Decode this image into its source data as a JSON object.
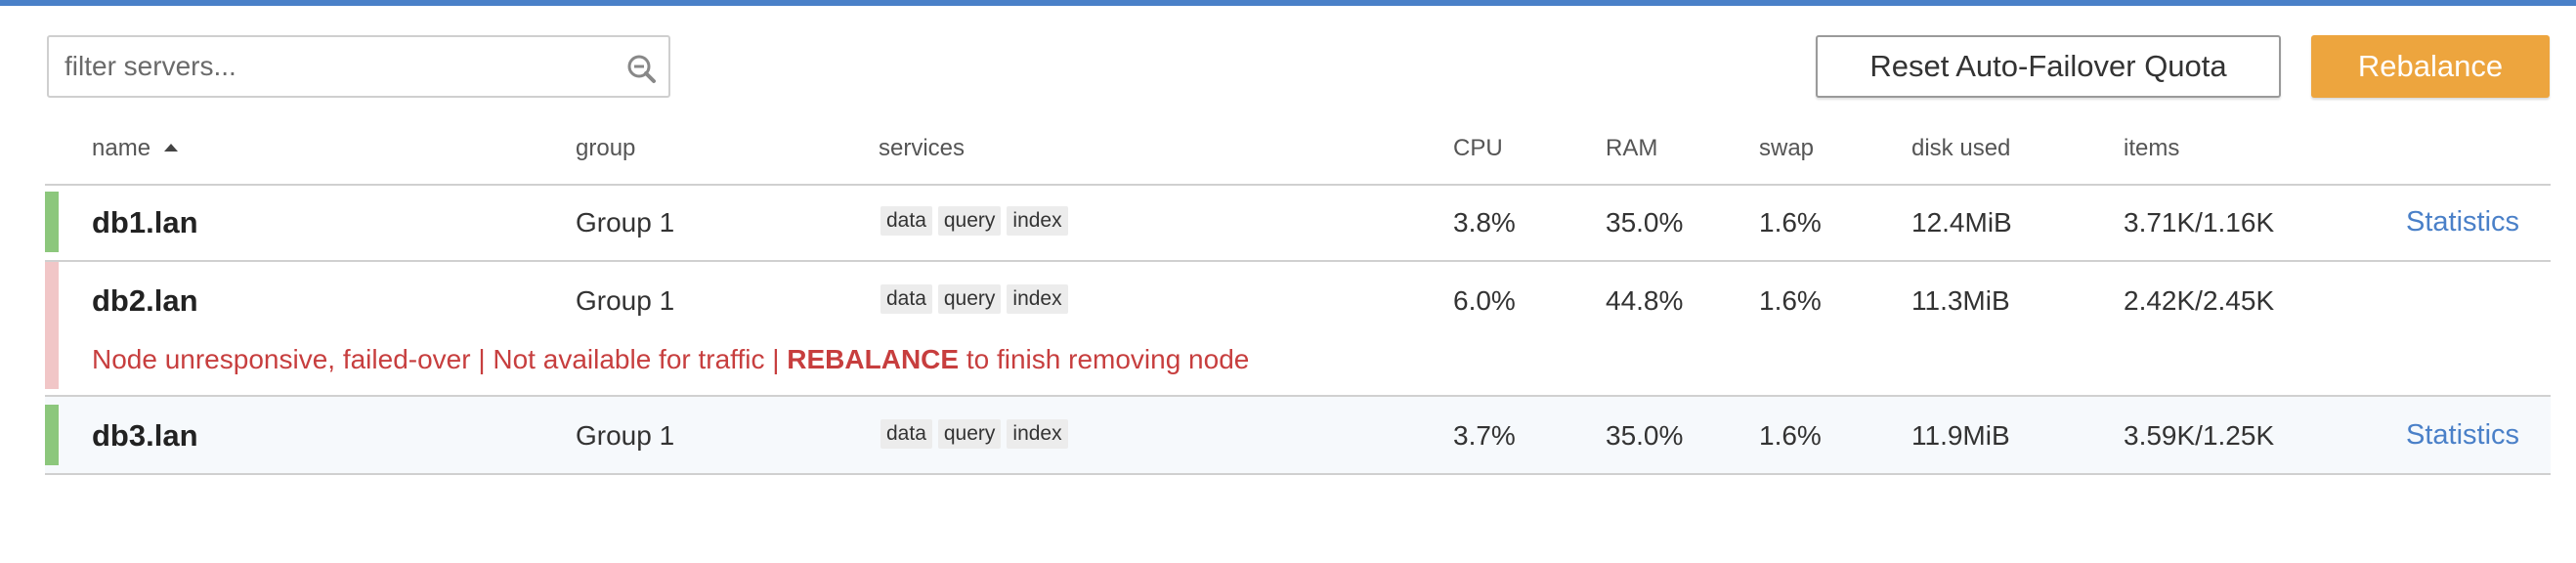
{
  "filter": {
    "placeholder": "filter servers..."
  },
  "buttons": {
    "reset_label": "Reset Auto-Failover Quota",
    "rebalance_label": "Rebalance"
  },
  "columns": {
    "name": "name",
    "group": "group",
    "services": "services",
    "cpu": "CPU",
    "ram": "RAM",
    "swap": "swap",
    "disk": "disk used",
    "items": "items"
  },
  "servers": [
    {
      "name": "db1.lan",
      "group": "Group 1",
      "services": [
        "data",
        "query",
        "index"
      ],
      "cpu": "3.8%",
      "ram": "35.0%",
      "swap": "1.6%",
      "disk": "12.4MiB",
      "items": "3.71K/1.16K",
      "stats_label": "Statistics",
      "status": "healthy"
    },
    {
      "name": "db2.lan",
      "group": "Group 1",
      "services": [
        "data",
        "query",
        "index"
      ],
      "cpu": "6.0%",
      "ram": "44.8%",
      "swap": "1.6%",
      "disk": "11.3MiB",
      "items": "2.42K/2.45K",
      "status": "failed-over",
      "warning": {
        "prefix": "Node unresponsive, failed-over | Not available for traffic | ",
        "emphasis": "REBALANCE",
        "suffix": " to finish removing node"
      }
    },
    {
      "name": "db3.lan",
      "group": "Group 1",
      "services": [
        "data",
        "query",
        "index"
      ],
      "cpu": "3.7%",
      "ram": "35.0%",
      "swap": "1.6%",
      "disk": "11.9MiB",
      "items": "3.59K/1.25K",
      "stats_label": "Statistics",
      "status": "healthy"
    }
  ],
  "colors": {
    "accent": "#4a80c8",
    "rebalance": "#eda53e",
    "healthy": "#8cc77c",
    "failed": "#f1c6c7",
    "warning_text": "#c73e3e"
  }
}
